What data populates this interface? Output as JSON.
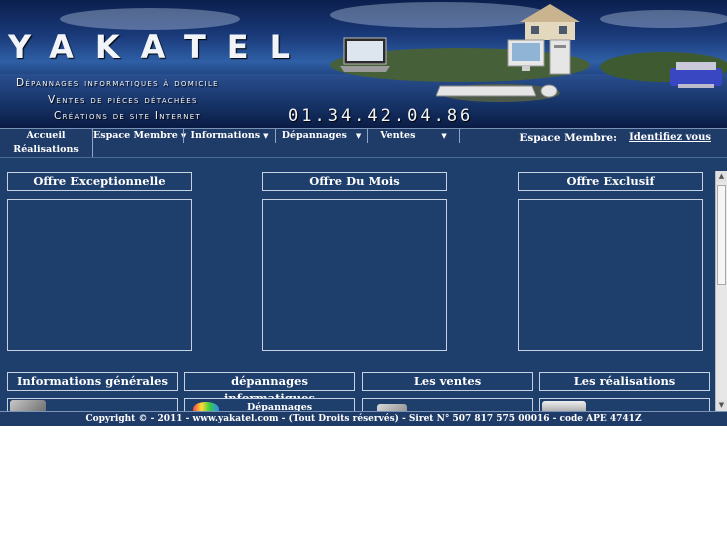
{
  "header": {
    "brand": "YAKATEL",
    "taglines": [
      "Dépannages informatiques à domicile",
      "Ventes de pièces détachées",
      "Créations de site Internet"
    ],
    "phone": "01.34.42.04.86"
  },
  "menu": {
    "items": [
      {
        "label": "Accueil",
        "has_dropdown": false
      },
      {
        "label": "Espace Membre",
        "has_dropdown": true
      },
      {
        "label": "Informations",
        "has_dropdown": true
      },
      {
        "label": "Dépannages",
        "has_dropdown": true
      },
      {
        "label": "Ventes",
        "has_dropdown": true
      }
    ],
    "second_row": [
      {
        "label": "Réalisations",
        "has_dropdown": false
      }
    ],
    "member_label": "Espace Membre:",
    "member_link": "Identifiez vous",
    "dropdown_icon": "caret-down-icon"
  },
  "offers": [
    {
      "title": "Offre Exceptionnelle"
    },
    {
      "title": "Offre Du Mois"
    },
    {
      "title": "Offre Exclusif"
    }
  ],
  "sections": [
    {
      "title": "Informations générales"
    },
    {
      "title": "dépannages informatiques",
      "card_text": "Dépannages système"
    },
    {
      "title": "Les ventes"
    },
    {
      "title": "Les réalisations"
    }
  ],
  "footer": {
    "text": "Copyright © - 2011 - www.yakatel.com - (Tout Droits réservés) - Siret N° 507 817 575 00016 - code APE 4741Z"
  },
  "colors": {
    "menu_bg": "#1f3c68",
    "content_bg": "#1e3f6b",
    "border": "#c6d2e2",
    "text": "#ffffff"
  }
}
